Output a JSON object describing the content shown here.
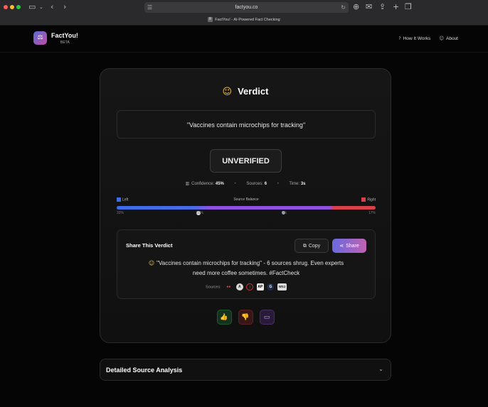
{
  "browser": {
    "url": "factyou.co",
    "tab_title": "FactYou! - AI-Powered Fact Checking",
    "tab_favicon": "F"
  },
  "header": {
    "brand": "FactYou!",
    "badge": "BETA",
    "logo_icon": "scale-icon",
    "nav": [
      {
        "label": "How It Works",
        "icon": "help-circle-icon"
      },
      {
        "label": "About",
        "icon": "user-icon"
      }
    ]
  },
  "verdict": {
    "title": "Verdict",
    "emoji": "thinking-face",
    "claim": "\"Vaccines contain microchips for tracking\"",
    "status": "UNVERIFIED",
    "confidence_label": "Confidence:",
    "confidence_value": "45%",
    "sources_label": "Sources:",
    "sources_value": "6",
    "time_label": "Time:",
    "time_value": "3s"
  },
  "balance": {
    "left_label": "Left",
    "center_label": "Source Balance",
    "right_label": "Right",
    "left_pct": "33%",
    "center_pct": "50%",
    "center2_pct": "0%",
    "right_pct": "17%",
    "left_color": "#3d6ce8",
    "center_color": "#8f52e0",
    "right_color": "#d8404a"
  },
  "share": {
    "title": "Share This Verdict",
    "copy_label": "Copy",
    "share_label": "Share",
    "text_line1": "\"Vaccines contain microchips for tracking\" - 6 sources shrug. Even experts",
    "text_line2": "need more coffee sometimes. #FactCheck",
    "sources_label": "Sources:",
    "source_icons": [
      "nbc-icon",
      "a-icon",
      "circle-icon",
      "AP",
      "G",
      "WSJ"
    ]
  },
  "detail": {
    "title": "Detailed Source Analysis"
  }
}
